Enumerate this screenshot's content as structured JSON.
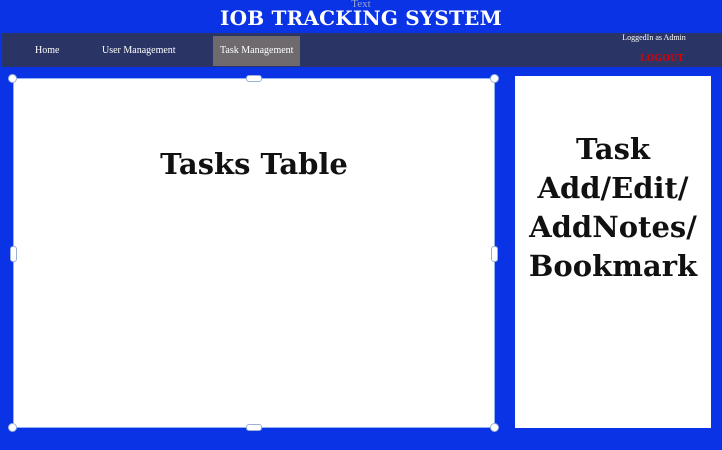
{
  "header": {
    "ghost_text": "Text",
    "title": "IOB TRACKING SYSTEM"
  },
  "nav": {
    "items": [
      {
        "label": "Home",
        "active": false
      },
      {
        "label": "User Management",
        "active": false
      },
      {
        "label": "Task Management",
        "active": true
      }
    ],
    "user_status": "LoggedIn as Admin",
    "logout_label": "LOGOUT"
  },
  "main": {
    "tasks_panel_title": "Tasks Table",
    "side_panel_lines": [
      "Task",
      "Add/Edit/",
      "AddNotes/",
      "Bookmark"
    ]
  },
  "colors": {
    "background": "#0a33e6",
    "navbar": "#2a3566",
    "active_tab": "#6e6a6e",
    "logout": "#e00000"
  }
}
